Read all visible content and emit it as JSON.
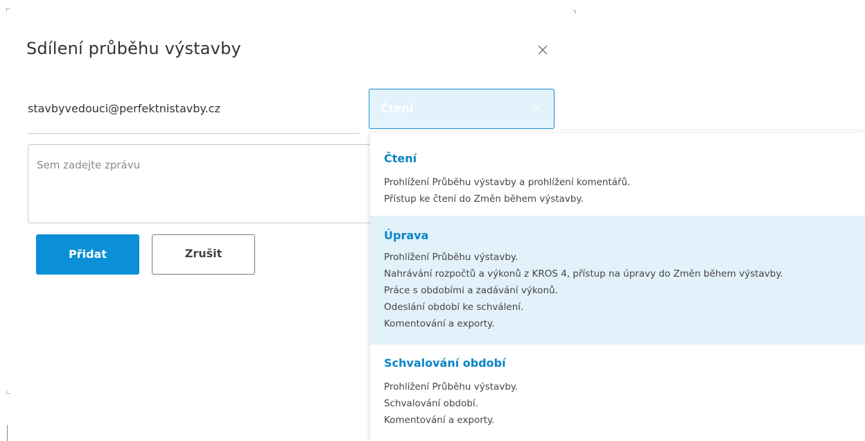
{
  "dialog": {
    "title": "Sdílení průběhu výstavby",
    "close_icon": "close-icon"
  },
  "share": {
    "email_value": "stavbyvedouci@perfektnistavby.cz",
    "permission_selected": "Čtení",
    "message_placeholder": "Sem zadejte zprávu"
  },
  "buttons": {
    "add_label": "Přidat",
    "cancel_label": "Zrušit"
  },
  "dropdown": {
    "options": [
      {
        "title": "Čtení",
        "lines": [
          "Prohlížení Průběhu výstavby a prohlížení komentářů.",
          "Přístup ke čtení do Změn během výstavby."
        ]
      },
      {
        "title": "Úprava",
        "lines": [
          "Prohlížení Průběhu výstavby.",
          "Nahrávání rozpočtů a výkonů z KROS 4, přístup na úpravy do Změn během výstavby.",
          "Práce s obdobími a zadávání výkonů.",
          "Odeslání období ke schválení.",
          "Komentování a exporty."
        ]
      },
      {
        "title": "Schvalování období",
        "lines": [
          "Prohlížení Průběhu výstavby.",
          "Schvalování období.",
          "Komentování a exporty."
        ]
      }
    ]
  },
  "colors": {
    "accent": "#0b8fd6",
    "option_title": "#0a84c6",
    "highlight": "#e3f1fa"
  }
}
